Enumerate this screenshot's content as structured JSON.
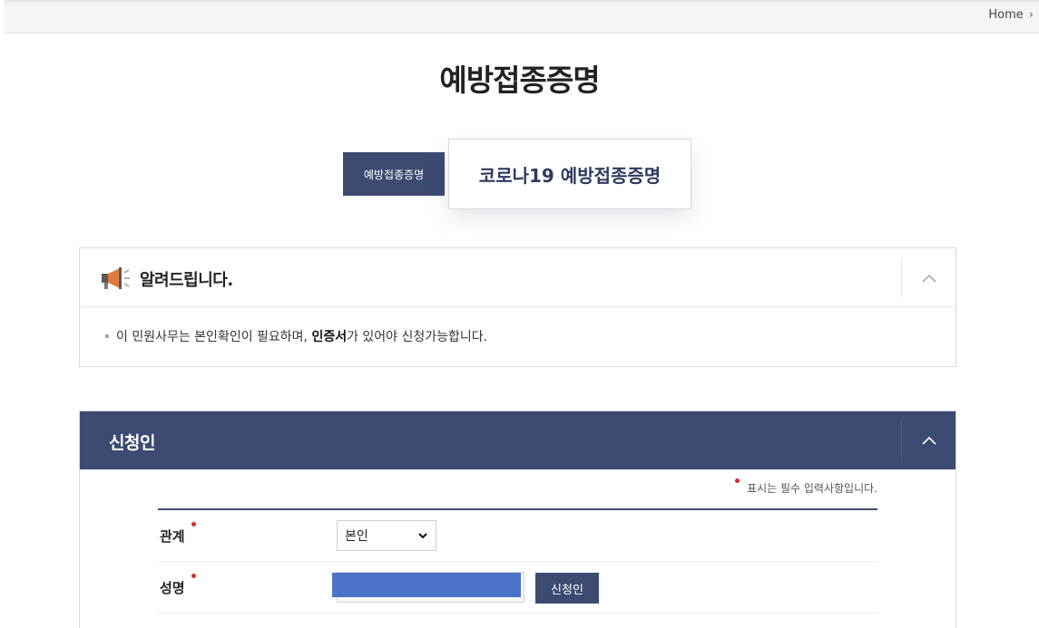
{
  "breadcrumb": {
    "home": "Home"
  },
  "page": {
    "title": "예방접종증명"
  },
  "tabs": [
    {
      "label": "예방접종증명"
    },
    {
      "label": "코로나19 예방접종증명"
    }
  ],
  "notice": {
    "title": "알려드립니다.",
    "text_before": "이 민원사무는 본인확인이 필요하며, ",
    "text_bold": "인증서",
    "text_after": "가 있어야 신청가능합니다."
  },
  "applicant": {
    "title": "신청인",
    "required_note": "표시는 필수 입력사항입니다.",
    "relation_label": "관계",
    "relation_value": "본인",
    "name_label": "성명",
    "name_button": "신청인"
  },
  "colors": {
    "primary": "#3d4a72",
    "required": "#d62b2b",
    "redacted": "#4a74c7"
  }
}
